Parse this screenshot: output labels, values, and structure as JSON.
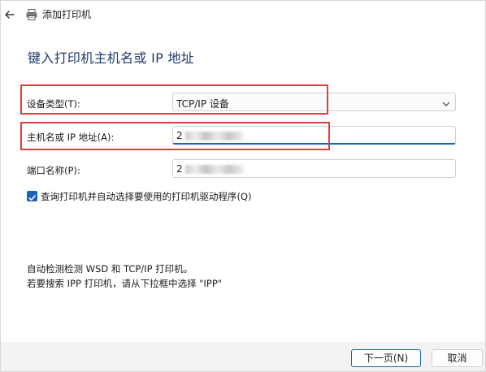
{
  "window": {
    "title": "添加打印机"
  },
  "heading": "键入打印机主机名或 IP 地址",
  "form": {
    "device_type_label": "设备类型(T):",
    "device_type_value": "TCP/IP 设备",
    "hostname_label": "主机名或 IP 地址(A):",
    "hostname_value": "2",
    "port_label": "端口名称(P):",
    "port_value": "2"
  },
  "checkbox": {
    "label": "查询打印机并自动选择要使用的打印机驱动程序(Q)",
    "checked": true
  },
  "info": {
    "line1": "自动检测检测 WSD 和 TCP/IP 打印机。",
    "line2": "若要搜索 IPP 打印机，请从下拉框中选择 \"IPP\""
  },
  "buttons": {
    "next": "下一页(N)",
    "cancel": "取消"
  },
  "colors": {
    "accent": "#1b63b4",
    "highlight_box": "#e03c3c",
    "heading": "#1e3a6e"
  },
  "icons": [
    "back-arrow-icon",
    "printer-icon",
    "chevron-down-icon",
    "checkmark-icon"
  ]
}
